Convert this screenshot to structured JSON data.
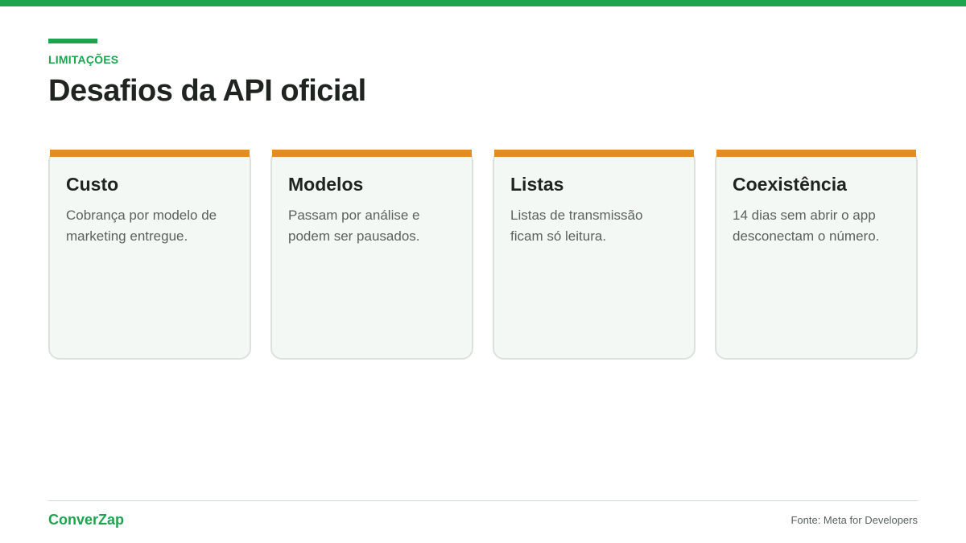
{
  "colors": {
    "brand": "#1ea44f",
    "card_accent": "#e08e22",
    "card_background": "#f3f8f4",
    "title": "#1f2421",
    "body_text": "#5b625e"
  },
  "header": {
    "eyebrow": "LIMITAÇÕES",
    "title": "Desafios da API oficial"
  },
  "cards": [
    {
      "title": "Custo",
      "text": "Cobrança por modelo de marketing entregue."
    },
    {
      "title": "Modelos",
      "text": "Passam por análise e podem ser pausados."
    },
    {
      "title": "Listas",
      "text": "Listas de transmissão ficam só leitura."
    },
    {
      "title": "Coexistência",
      "text": "14 dias sem abrir o app desconectam o número."
    }
  ],
  "footer": {
    "brand": "ConverZap",
    "source": "Fonte: Meta for Developers"
  }
}
